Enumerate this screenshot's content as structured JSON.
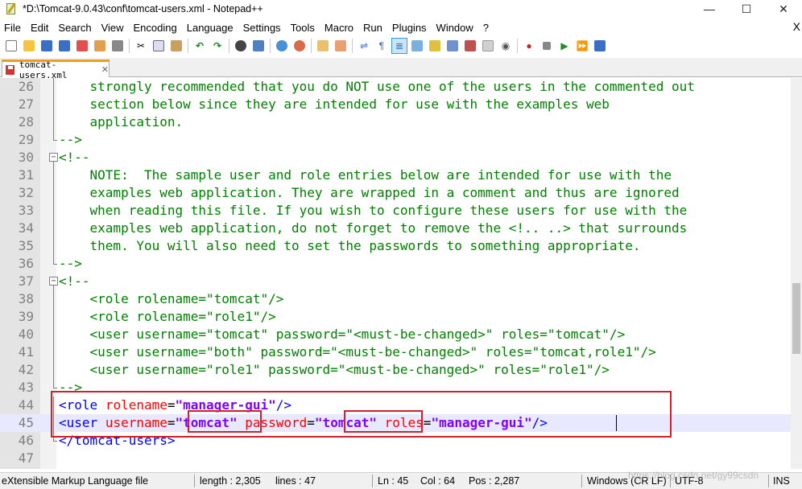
{
  "window": {
    "title": "*D:\\Tomcat-9.0.43\\conf\\tomcat-users.xml - Notepad++",
    "minimize": "—",
    "maximize": "☐",
    "close": "✕"
  },
  "menu": {
    "items": [
      "File",
      "Edit",
      "Search",
      "View",
      "Encoding",
      "Language",
      "Settings",
      "Tools",
      "Macro",
      "Run",
      "Plugins",
      "Window",
      "?"
    ],
    "close": "X"
  },
  "tab": {
    "label": "tomcat-users.xml",
    "close": "✕"
  },
  "editor": {
    "lines": [
      {
        "n": "26",
        "tokens": [
          {
            "t": "    strongly recommended that you do NOT use one of the users in the commented out",
            "c": "comment"
          }
        ]
      },
      {
        "n": "27",
        "tokens": [
          {
            "t": "    section below since they are intended for use with the examples web",
            "c": "comment"
          }
        ]
      },
      {
        "n": "28",
        "tokens": [
          {
            "t": "    application.",
            "c": "comment"
          }
        ]
      },
      {
        "n": "29",
        "tokens": [
          {
            "t": "-->",
            "c": "comment"
          }
        ]
      },
      {
        "n": "30",
        "tokens": [
          {
            "t": "<!--",
            "c": "comment"
          }
        ]
      },
      {
        "n": "31",
        "tokens": [
          {
            "t": "    NOTE:  The sample user and role entries below are intended for use with the",
            "c": "comment"
          }
        ]
      },
      {
        "n": "32",
        "tokens": [
          {
            "t": "    examples web application. They are wrapped in a comment and thus are ignored",
            "c": "comment"
          }
        ]
      },
      {
        "n": "33",
        "tokens": [
          {
            "t": "    when reading this file. If you wish to configure these users for use with the",
            "c": "comment"
          }
        ]
      },
      {
        "n": "34",
        "tokens": [
          {
            "t": "    examples web application, do not forget to remove the <!.. ..> that surrounds",
            "c": "comment"
          }
        ]
      },
      {
        "n": "35",
        "tokens": [
          {
            "t": "    them. You will also need to set the passwords to something appropriate.",
            "c": "comment"
          }
        ]
      },
      {
        "n": "36",
        "tokens": [
          {
            "t": "-->",
            "c": "comment"
          }
        ]
      },
      {
        "n": "37",
        "tokens": [
          {
            "t": "<!--",
            "c": "comment"
          }
        ]
      },
      {
        "n": "38",
        "tokens": [
          {
            "t": "    <role rolename=\"tomcat\"/>",
            "c": "comment"
          }
        ]
      },
      {
        "n": "39",
        "tokens": [
          {
            "t": "    <role rolename=\"role1\"/>",
            "c": "comment"
          }
        ]
      },
      {
        "n": "40",
        "tokens": [
          {
            "t": "    <user username=\"tomcat\" password=\"<must-be-changed>\" roles=\"tomcat\"/>",
            "c": "comment"
          }
        ]
      },
      {
        "n": "41",
        "tokens": [
          {
            "t": "    <user username=\"both\" password=\"<must-be-changed>\" roles=\"tomcat,role1\"/>",
            "c": "comment"
          }
        ]
      },
      {
        "n": "42",
        "tokens": [
          {
            "t": "    <user username=\"role1\" password=\"<must-be-changed>\" roles=\"role1\"/>",
            "c": "comment"
          }
        ]
      },
      {
        "n": "43",
        "tokens": [
          {
            "t": "-->",
            "c": "comment"
          }
        ]
      },
      {
        "n": "44",
        "tokens": [
          {
            "t": "<role",
            "c": "tag"
          },
          {
            "t": " ",
            "c": "plain"
          },
          {
            "t": "rolename",
            "c": "attr"
          },
          {
            "t": "=",
            "c": "plain"
          },
          {
            "t": "\"manager-gui\"",
            "c": "val"
          },
          {
            "t": "/>",
            "c": "tag"
          }
        ]
      },
      {
        "n": "45",
        "current": true,
        "tokens": [
          {
            "t": "<user",
            "c": "tag"
          },
          {
            "t": " ",
            "c": "plain"
          },
          {
            "t": "username",
            "c": "attr"
          },
          {
            "t": "=",
            "c": "plain"
          },
          {
            "t": "\"tomcat\"",
            "c": "val"
          },
          {
            "t": " ",
            "c": "plain"
          },
          {
            "t": "password",
            "c": "attr"
          },
          {
            "t": "=",
            "c": "plain"
          },
          {
            "t": "\"tomcat\"",
            "c": "val"
          },
          {
            "t": " ",
            "c": "plain"
          },
          {
            "t": "roles",
            "c": "attr"
          },
          {
            "t": "=",
            "c": "plain"
          },
          {
            "t": "\"manager-gui\"",
            "c": "val"
          },
          {
            "t": "/>",
            "c": "tag"
          }
        ]
      },
      {
        "n": "46",
        "tokens": [
          {
            "t": "</tomcat-users>",
            "c": "tag"
          }
        ]
      },
      {
        "n": "47",
        "tokens": []
      }
    ]
  },
  "status": {
    "file_type": "eXtensible Markup Language file",
    "length": "length : 2,305",
    "lines": "lines : 47",
    "ln": "Ln : 45",
    "col": "Col : 64",
    "pos": "Pos : 2,287",
    "eol": "Windows (CR LF)",
    "encoding": "UTF-8",
    "mode": "INS"
  },
  "watermark": "https://blog.csdn.net/gy99csdn",
  "colors": {
    "comment": "#008000",
    "tag": "#0000ff",
    "attr": "#ff0000",
    "value": "#8000ff",
    "highlight_box": "#d0202a",
    "tab_accent": "#f39a1d"
  }
}
